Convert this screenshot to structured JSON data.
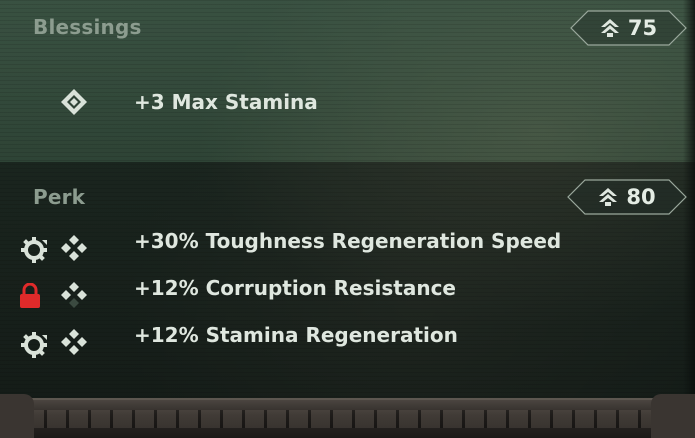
{
  "blessings": {
    "title": "Blessings",
    "cost": "75",
    "cost_icon": "rank-chevron-icon",
    "items": [
      {
        "icon": "diamond-cluster-icon",
        "text": "+3 Max Stamina"
      }
    ]
  },
  "perk": {
    "title": "Perk",
    "cost": "80",
    "cost_icon": "rank-chevron-icon",
    "items": [
      {
        "status_icon": "gear-cycle-icon",
        "icon": "diamond-cluster-icon",
        "text": "+30% Toughness Regeneration Speed"
      },
      {
        "status_icon": "padlock-icon",
        "icon": "diamond-cluster-icon",
        "text": "+12% Corruption Resistance"
      },
      {
        "status_icon": "gear-cycle-icon",
        "icon": "diamond-cluster-icon",
        "text": "+12% Stamina Regeneration"
      }
    ]
  },
  "colors": {
    "text": "#dfe7df",
    "title": "#8c9c8f",
    "lock": "#e02a2a"
  }
}
